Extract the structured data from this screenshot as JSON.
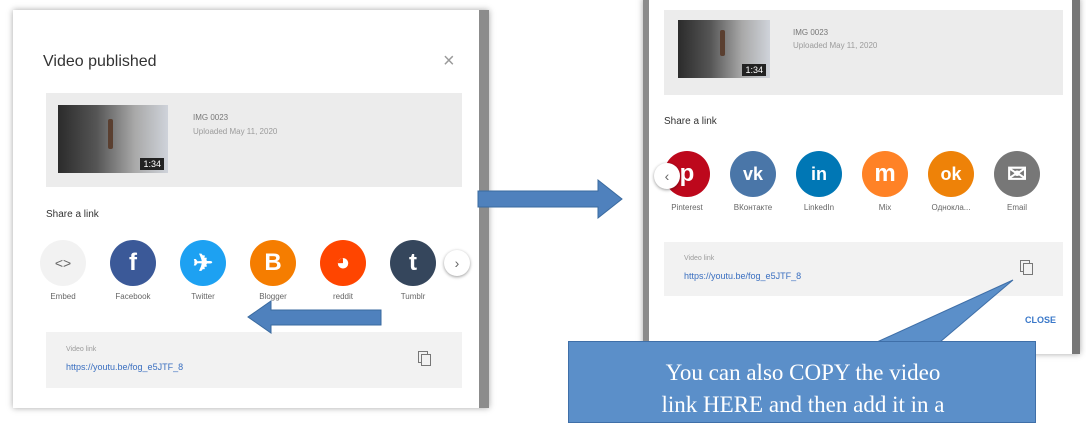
{
  "left_dialog": {
    "title": "Video published",
    "close_glyph": "×",
    "video": {
      "name": "IMG 0023",
      "uploaded": "Uploaded May 11, 2020",
      "duration": "1:34"
    },
    "share_label": "Share a link",
    "share_items": [
      {
        "label": "Embed",
        "icon": "embed-icon",
        "glyph": "<>",
        "color": "#f2f2f2"
      },
      {
        "label": "Facebook",
        "icon": "facebook-icon",
        "glyph": "f",
        "color": "#3b5998"
      },
      {
        "label": "Twitter",
        "icon": "twitter-icon",
        "glyph": "✈",
        "color": "#1da1f2"
      },
      {
        "label": "Blogger",
        "icon": "blogger-icon",
        "glyph": "B",
        "color": "#f57d00"
      },
      {
        "label": "reddit",
        "icon": "reddit-icon",
        "glyph": "◕",
        "color": "#ff4500"
      },
      {
        "label": "Tumblr",
        "icon": "tumblr-icon",
        "glyph": "t",
        "color": "#35465c"
      }
    ],
    "next_glyph": "›",
    "link_label": "Video link",
    "link_url": "https://youtu.be/fog_e5JTF_8"
  },
  "right_dialog": {
    "video": {
      "name": "IMG 0023",
      "uploaded": "Uploaded May 11, 2020",
      "duration": "1:34"
    },
    "share_label": "Share a link",
    "prev_glyph": "‹",
    "share_items": [
      {
        "label": "Pinterest",
        "icon": "pinterest-icon",
        "glyph": "p",
        "color": "#bd081c"
      },
      {
        "label": "ВКонтакте",
        "icon": "vk-icon",
        "glyph": "vk",
        "color": "#4a76a8"
      },
      {
        "label": "LinkedIn",
        "icon": "linkedin-icon",
        "glyph": "in",
        "color": "#0077b5"
      },
      {
        "label": "Mix",
        "icon": "mix-icon",
        "glyph": "m",
        "color": "#ff8226"
      },
      {
        "label": "Одноклa...",
        "icon": "odnoklassniki-icon",
        "glyph": "ok",
        "color": "#ee8208"
      },
      {
        "label": "Email",
        "icon": "email-icon",
        "glyph": "✉",
        "color": "#777777"
      }
    ],
    "link_label": "Video link",
    "link_url": "https://youtu.be/fog_e5JTF_8",
    "close_label": "CLOSE"
  },
  "callout": {
    "lines": [
      "You can also COPY the video",
      "link HERE and then add it in a"
    ],
    "color": "#5b8fc9"
  },
  "arrow_color": "#4f81bd"
}
